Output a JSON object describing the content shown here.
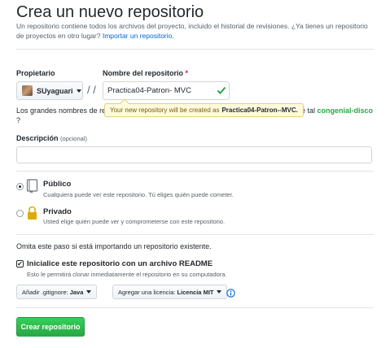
{
  "header": {
    "title": "Crea un nuevo repositorio",
    "subtitle": "Un repositorio contiene todos los archivos del proyecto, incluido el historial de revisiones. ¿Ya tienes un repositorio de proyectos en otro lugar?",
    "import_link": "Importar un repositorio."
  },
  "owner": {
    "label": "Propietario",
    "value": "SUyaguari"
  },
  "separator": "/",
  "repo_name": {
    "label": "Nombre del repositorio",
    "required_mark": "*",
    "value": "Practica04-Patron- MVC",
    "valid_icon": "check-icon"
  },
  "tooltip": {
    "text": "Your new repository will be created as",
    "name": "Practica04-Patron--MVC."
  },
  "name_hint": {
    "left": "Los grandes nombres de re",
    "right": "ué tal",
    "suggestion": "congenial-disco",
    "trailing": "?"
  },
  "description": {
    "label": "Descripción",
    "optional": "(opcional)",
    "value": ""
  },
  "visibility": {
    "public": {
      "title": "Público",
      "desc": "Cualquiera puede ver este repositorio. Tú eliges quién puede cometer.",
      "selected": true,
      "icon": "repo-book-icon"
    },
    "private": {
      "title": "Privado",
      "desc": "Usted elige quién puede ver y comprometerse con este repositorio.",
      "selected": false,
      "icon": "lock-icon"
    }
  },
  "init": {
    "note": "Omita este paso si está importando un repositorio existente.",
    "checkbox_title": "Inicialice este repositorio con un archivo README",
    "checkbox_desc": "Esto le permitirá clonar inmediatamente el repositorio en su computadora.",
    "checked": true
  },
  "gitignore": {
    "label": "Añadir .gitignore:",
    "value": "Java"
  },
  "license": {
    "label": "Agregar una licencia:",
    "value": "Licencia MIT"
  },
  "submit": {
    "label": "Crear repositorio"
  },
  "colors": {
    "accent_green": "#28a745",
    "link_blue": "#0366d6",
    "tooltip_bg": "#fffbdd",
    "required_red": "#cb2431"
  }
}
